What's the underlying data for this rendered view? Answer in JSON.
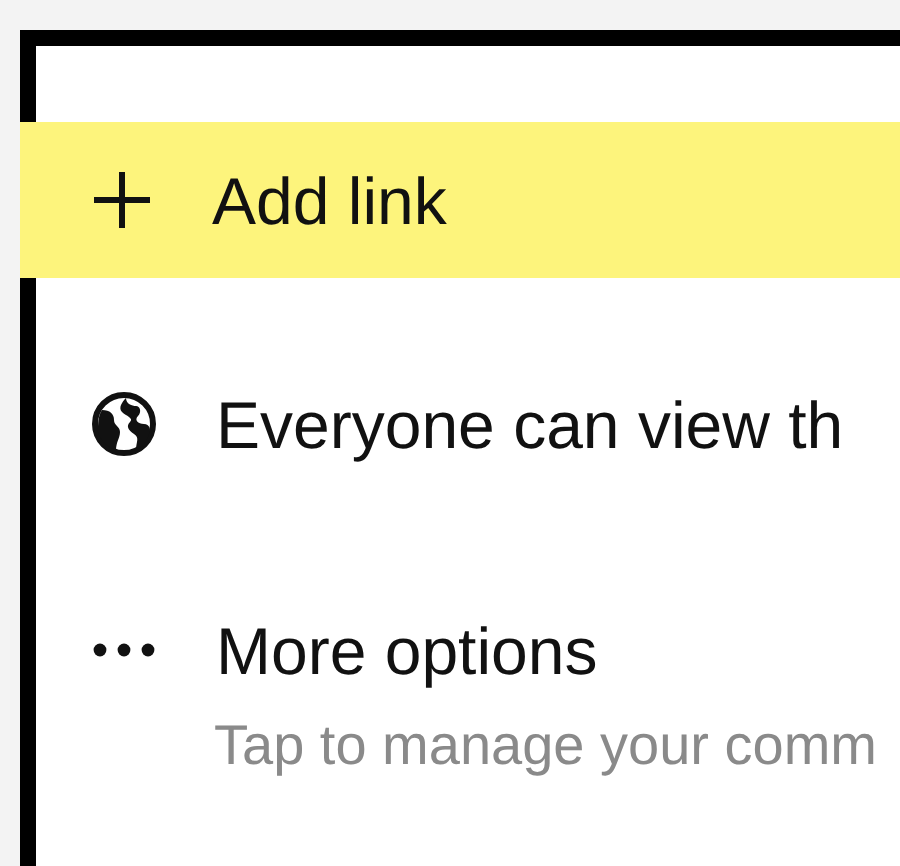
{
  "items": [
    {
      "kind": "add",
      "label": "Add link",
      "highlighted": true
    },
    {
      "kind": "visibility",
      "label": "Everyone can view th",
      "highlighted": false
    },
    {
      "kind": "more",
      "label": "More options",
      "subtitle": "Tap to manage your comm",
      "highlighted": false
    }
  ]
}
